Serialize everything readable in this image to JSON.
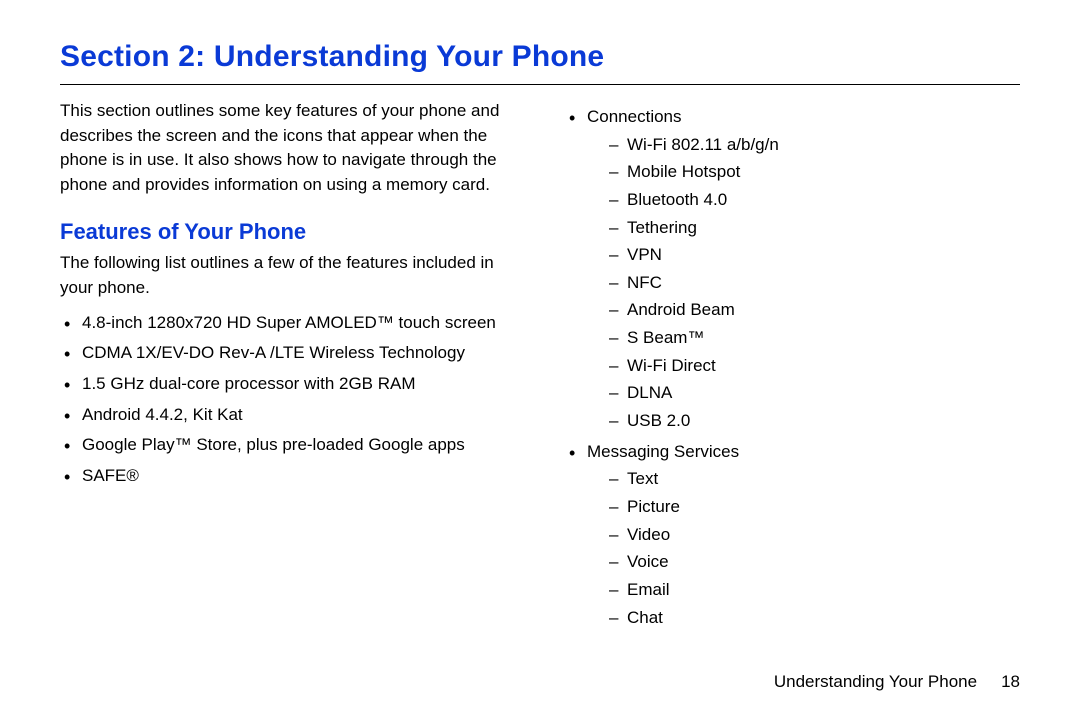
{
  "section_title": "Section 2: Understanding Your Phone",
  "intro": "This section outlines some key features of your phone and describes the screen and the icons that appear when the phone is in use. It also shows how to navigate through the phone and provides information on using a memory card.",
  "subheader": "Features of Your Phone",
  "lead": "The following list outlines a few of the features included in your phone.",
  "left_bullets": [
    "4.8-inch 1280x720 HD Super AMOLED™ touch screen",
    "CDMA 1X/EV-DO Rev-A /LTE Wireless Technology",
    "1.5 GHz dual-core processor with 2GB RAM",
    "Android 4.4.2, Kit Kat",
    "Google Play™ Store, plus pre-loaded Google apps",
    "SAFE®"
  ],
  "right_bullets": [
    {
      "label": "Connections",
      "children": [
        "Wi-Fi 802.11 a/b/g/n",
        "Mobile Hotspot",
        "Bluetooth 4.0",
        "Tethering",
        "VPN",
        "NFC",
        "Android Beam",
        "S Beam™",
        "Wi-Fi Direct",
        "DLNA",
        "USB 2.0"
      ]
    },
    {
      "label": "Messaging Services",
      "children": [
        "Text",
        "Picture",
        "Video",
        "Voice",
        "Email",
        "Chat"
      ]
    }
  ],
  "footer_label": "Understanding Your Phone",
  "footer_page": "18"
}
